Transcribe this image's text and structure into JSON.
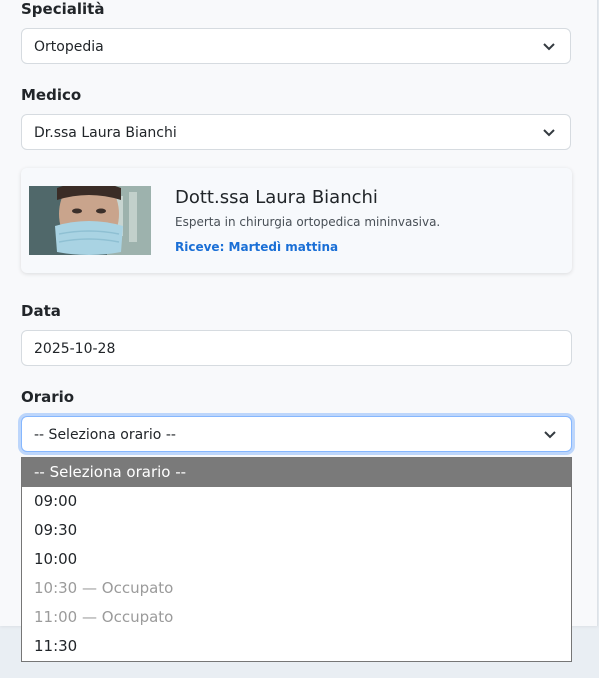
{
  "form": {
    "specialty": {
      "label": "Specialità",
      "value": "Ortopedia"
    },
    "doctor": {
      "label": "Medico",
      "value": "Dr.ssa Laura Bianchi"
    },
    "doctor_card": {
      "name": "Dott.ssa Laura Bianchi",
      "description": "Esperta in chirurgia ortopedica mininvasiva.",
      "receives": "Riceve: Martedì mattina"
    },
    "date": {
      "label": "Data",
      "value": "2025-10-28"
    },
    "time": {
      "label": "Orario",
      "value": "-- Seleziona orario --",
      "options": [
        {
          "label": "-- Seleziona orario --",
          "selected": true,
          "disabled": false
        },
        {
          "label": "09:00",
          "selected": false,
          "disabled": false
        },
        {
          "label": "09:30",
          "selected": false,
          "disabled": false
        },
        {
          "label": "10:00",
          "selected": false,
          "disabled": false
        },
        {
          "label": "10:30 — Occupato",
          "selected": false,
          "disabled": true
        },
        {
          "label": "11:00 — Occupato",
          "selected": false,
          "disabled": true
        },
        {
          "label": "11:30",
          "selected": false,
          "disabled": false
        }
      ]
    }
  },
  "icons": {
    "select_chevron": "chevron-down-icon",
    "doctor_photo": "doctor-photo"
  },
  "colors": {
    "focus_border": "#86b7fe",
    "accent_link": "#1a6fd6",
    "option_highlight": "#7a7a7a",
    "disabled_text": "#9b9b9b"
  }
}
